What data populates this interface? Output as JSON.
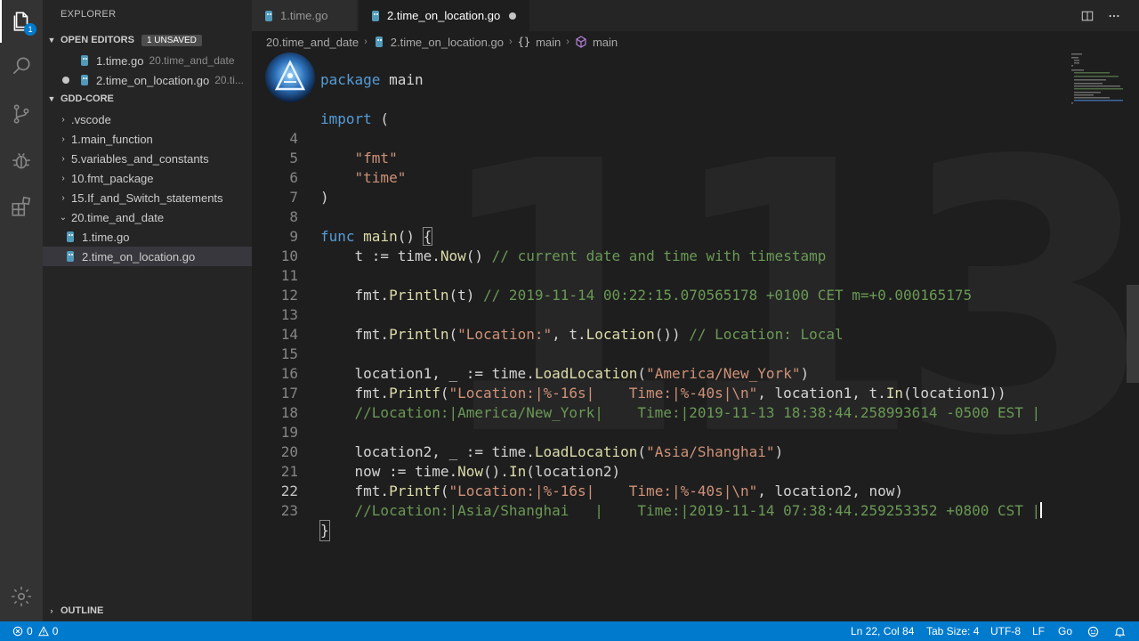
{
  "activity_bar": {
    "explorer_badge": "1",
    "items": [
      "explorer-icon",
      "search-icon",
      "source-control-icon",
      "debug-icon",
      "extensions-icon",
      "settings-gear-icon"
    ]
  },
  "sidebar": {
    "title": "EXPLORER",
    "open_editors": {
      "label": "OPEN EDITORS",
      "badge": "1 UNSAVED",
      "items": [
        {
          "name": "1.time.go",
          "desc": "20.time_and_date"
        },
        {
          "name": "2.time_on_location.go",
          "desc": "20.ti..."
        }
      ]
    },
    "workspace": {
      "label": "GDD-CORE",
      "folders": [
        ".vscode",
        "1.main_function",
        "5.variables_and_constants",
        "10.fmt_package",
        "15.If_and_Switch_statements",
        "20.time_and_date"
      ],
      "files": [
        "1.time.go",
        "2.time_on_location.go"
      ]
    },
    "outline_label": "OUTLINE"
  },
  "tabs": [
    {
      "label": "1.time.go",
      "active": false
    },
    {
      "label": "2.time_on_location.go",
      "active": true,
      "unsaved": true
    }
  ],
  "breadcrumb": {
    "folder": "20.time_and_date",
    "file": "2.time_on_location.go",
    "symbol1": "main",
    "symbol2": "main"
  },
  "editor": {
    "line_numbers": [
      "4",
      "5",
      "6",
      "7",
      "8",
      "9",
      "10",
      "11",
      "12",
      "13",
      "14",
      "15",
      "16",
      "17",
      "18",
      "19",
      "20",
      "21",
      "22",
      "23"
    ],
    "package_line": {
      "kw": "package",
      "name": " main"
    },
    "import_line": {
      "kw": "import",
      "rest": " ("
    },
    "fmt_import": "\"fmt\"",
    "time_import": "\"time\"",
    "close_paren": ")",
    "func_kw": "func",
    "func_name": "main",
    "func_rest": "() ",
    "open_brace": "{",
    "l9_code": "    t := time.",
    "l9_fn": "Now",
    "l9_rest": "() ",
    "l9_comment": "// current date and time with timestamp",
    "l11_a": "    fmt.",
    "l11_fn": "Println",
    "l11_b": "(t) ",
    "l11_comment": "// 2019-11-14 00:22:15.070565178 +0100 CET m=+0.000165175",
    "l13_a": "    fmt.",
    "l13_fn": "Println",
    "l13_b": "(",
    "l13_str": "\"Location:\"",
    "l13_c": ", t.",
    "l13_fn2": "Location",
    "l13_d": "()) ",
    "l13_comment": "// Location: Local",
    "l15_a": "    location1, _ := time.",
    "l15_fn": "LoadLocation",
    "l15_b": "(",
    "l15_str": "\"America/New_York\"",
    "l15_c": ")",
    "l16_a": "    fmt.",
    "l16_fn": "Printf",
    "l16_b": "(",
    "l16_str": "\"Location:|%-16s|    Time:|%-40s|\\n\"",
    "l16_c": ", location1, t.",
    "l16_fn2": "In",
    "l16_d": "(location1))",
    "l17_comment": "    //Location:|America/New_York|    Time:|2019-11-13 18:38:44.258993614 -0500 EST |",
    "l19_a": "    location2, _ := time.",
    "l19_fn": "LoadLocation",
    "l19_b": "(",
    "l19_str": "\"Asia/Shanghai\"",
    "l19_c": ")",
    "l20_a": "    now := time.",
    "l20_fn": "Now",
    "l20_b": "().",
    "l20_fn2": "In",
    "l20_c": "(location2)",
    "l21_a": "    fmt.",
    "l21_fn": "Printf",
    "l21_b": "(",
    "l21_str": "\"Location:|%-16s|    Time:|%-40s|\\n\"",
    "l21_c": ", location2, now)",
    "l22_comment": "    //Location:|Asia/Shanghai   |    Time:|2019-11-14 07:38:44.259253352 +0800 CST |",
    "close_brace": "}",
    "watermark": "113"
  },
  "status_bar": {
    "errors": "0",
    "warnings": "0",
    "position": "Ln 22, Col 84",
    "tab_size": "Tab Size: 4",
    "encoding": "UTF-8",
    "eol": "LF",
    "language": "Go"
  },
  "colors": {
    "accent": "#007acc",
    "keyword": "#569cd6",
    "string": "#ce9178",
    "function": "#dcdcaa",
    "comment": "#6a9955"
  }
}
